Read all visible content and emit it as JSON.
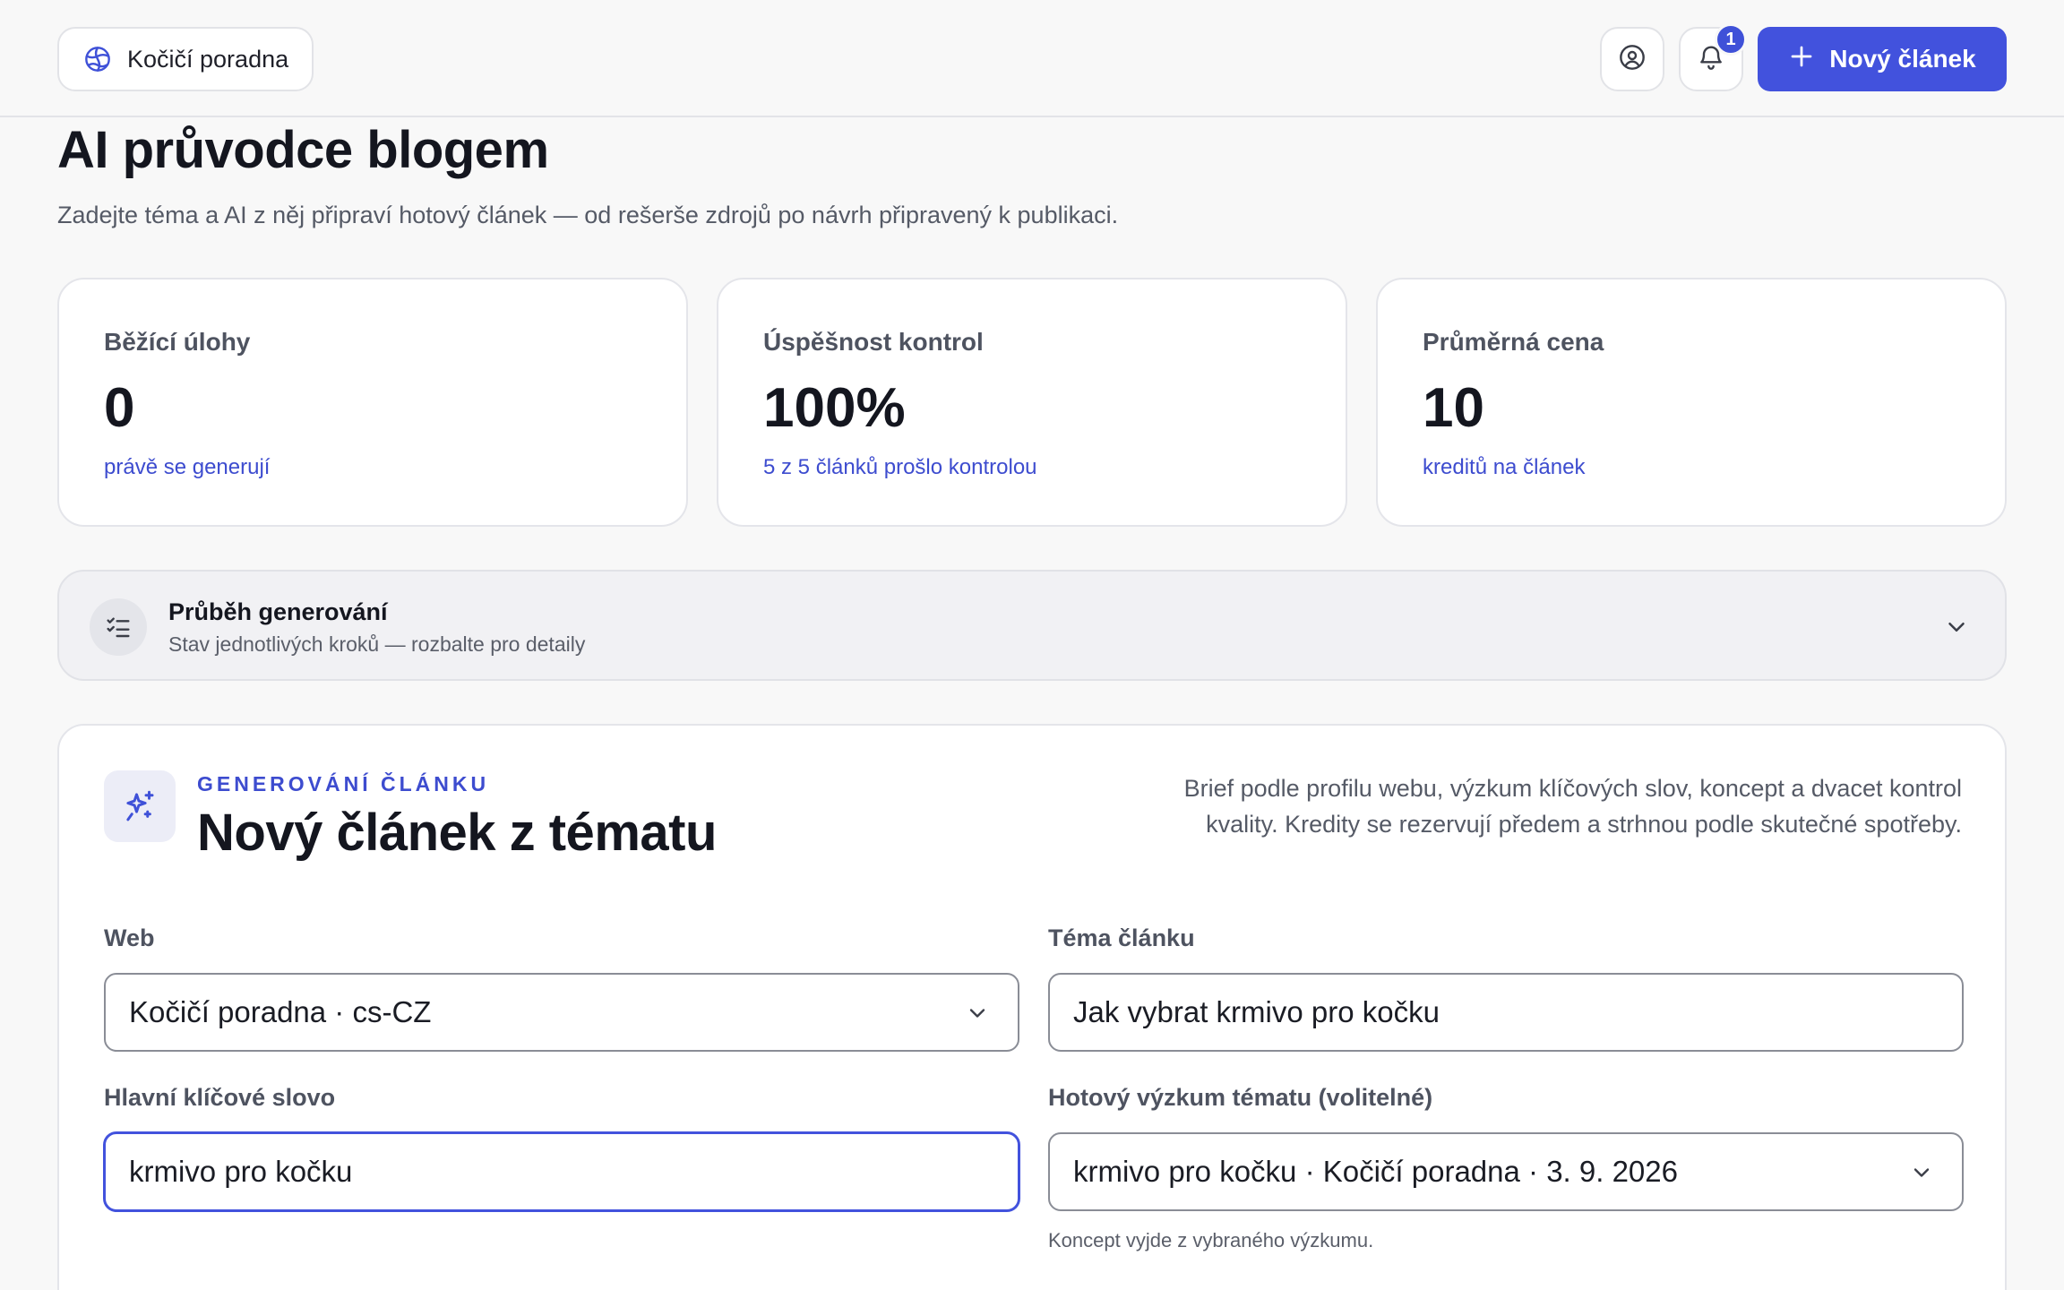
{
  "header": {
    "site_name": "Kočičí poradna",
    "notifications_count": "1",
    "new_article_label": "Nový článek"
  },
  "page": {
    "title": "AI průvodce blogem",
    "subtitle": "Zadejte téma a AI z něj připraví hotový článek — od rešerše zdrojů po návrh připravený k publikaci."
  },
  "stats": [
    {
      "label": "Běžící úlohy",
      "value": "0",
      "note": "právě se generují"
    },
    {
      "label": "Úspěšnost kontrol",
      "value": "100%",
      "note": "5 z 5 článků prošlo kontrolou"
    },
    {
      "label": "Průměrná cena",
      "value": "10",
      "note": "kreditů na článek"
    }
  ],
  "progress": {
    "title": "Průběh generování",
    "subtitle": "Stav jednotlivých kroků — rozbalte pro detaily"
  },
  "form": {
    "eyebrow": "GENEROVÁNÍ ČLÁNKU",
    "title": "Nový článek z tématu",
    "description": "Brief podle profilu webu, výzkum klíčových slov, koncept a dvacet kontrol kvality. Kredity se rezervují předem a strhnou podle skutečné spotřeby.",
    "web_label": "Web",
    "web_value": "Kočičí poradna · cs-CZ",
    "topic_label": "Téma článku",
    "topic_value": "Jak vybrat krmivo pro kočku",
    "keyword_label": "Hlavní klíčové slovo",
    "keyword_value": "krmivo pro kočku",
    "research_label": "Hotový výzkum tématu (volitelné)",
    "research_value": "krmivo pro kočku · Kočičí poradna · 3. 9. 2026",
    "research_hint": "Koncept vyjde z vybraného výzkumu."
  },
  "colors": {
    "accent": "#4252dd",
    "link": "#3d4ccf",
    "background": "#f8f8f8"
  },
  "icons": [
    "globe-icon",
    "user-circle-icon",
    "bell-icon",
    "plus-icon",
    "checklist-icon",
    "chevron-down-icon",
    "sparkles-icon"
  ]
}
